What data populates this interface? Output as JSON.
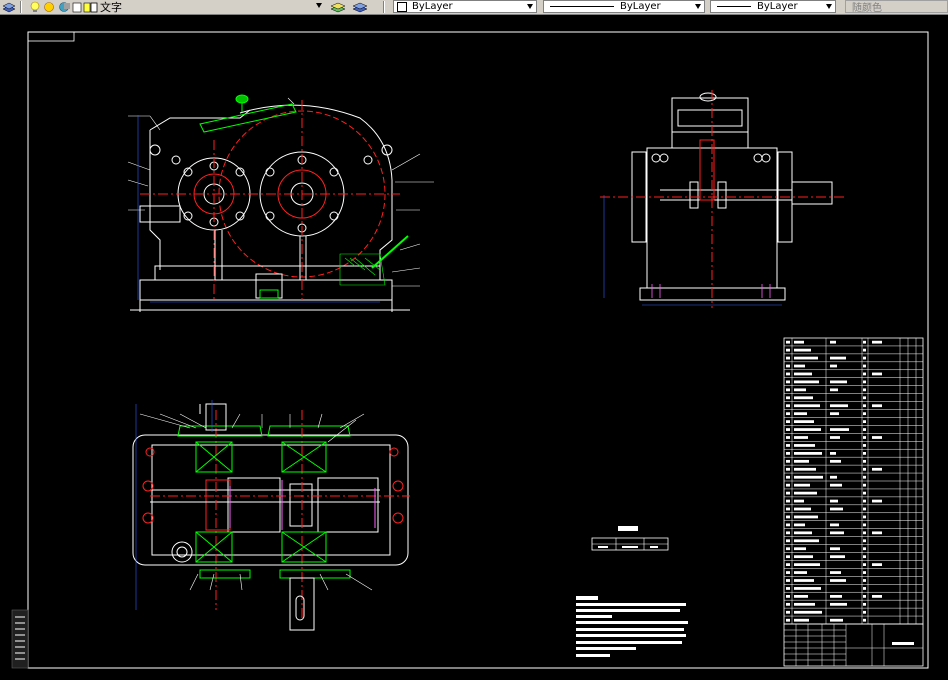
{
  "toolbar": {
    "text_style_label": "文字",
    "layer_value": "ByLayer",
    "linetype_value": "ByLayer",
    "lineweight_value": "ByLayer",
    "color_value": "随颜色"
  },
  "drawing": {
    "bg_color": "#000000",
    "red": "#ff2020",
    "green": "#00ff00",
    "white": "#ffffff",
    "blue": "#3060ff",
    "yellow": "#ffff00"
  }
}
